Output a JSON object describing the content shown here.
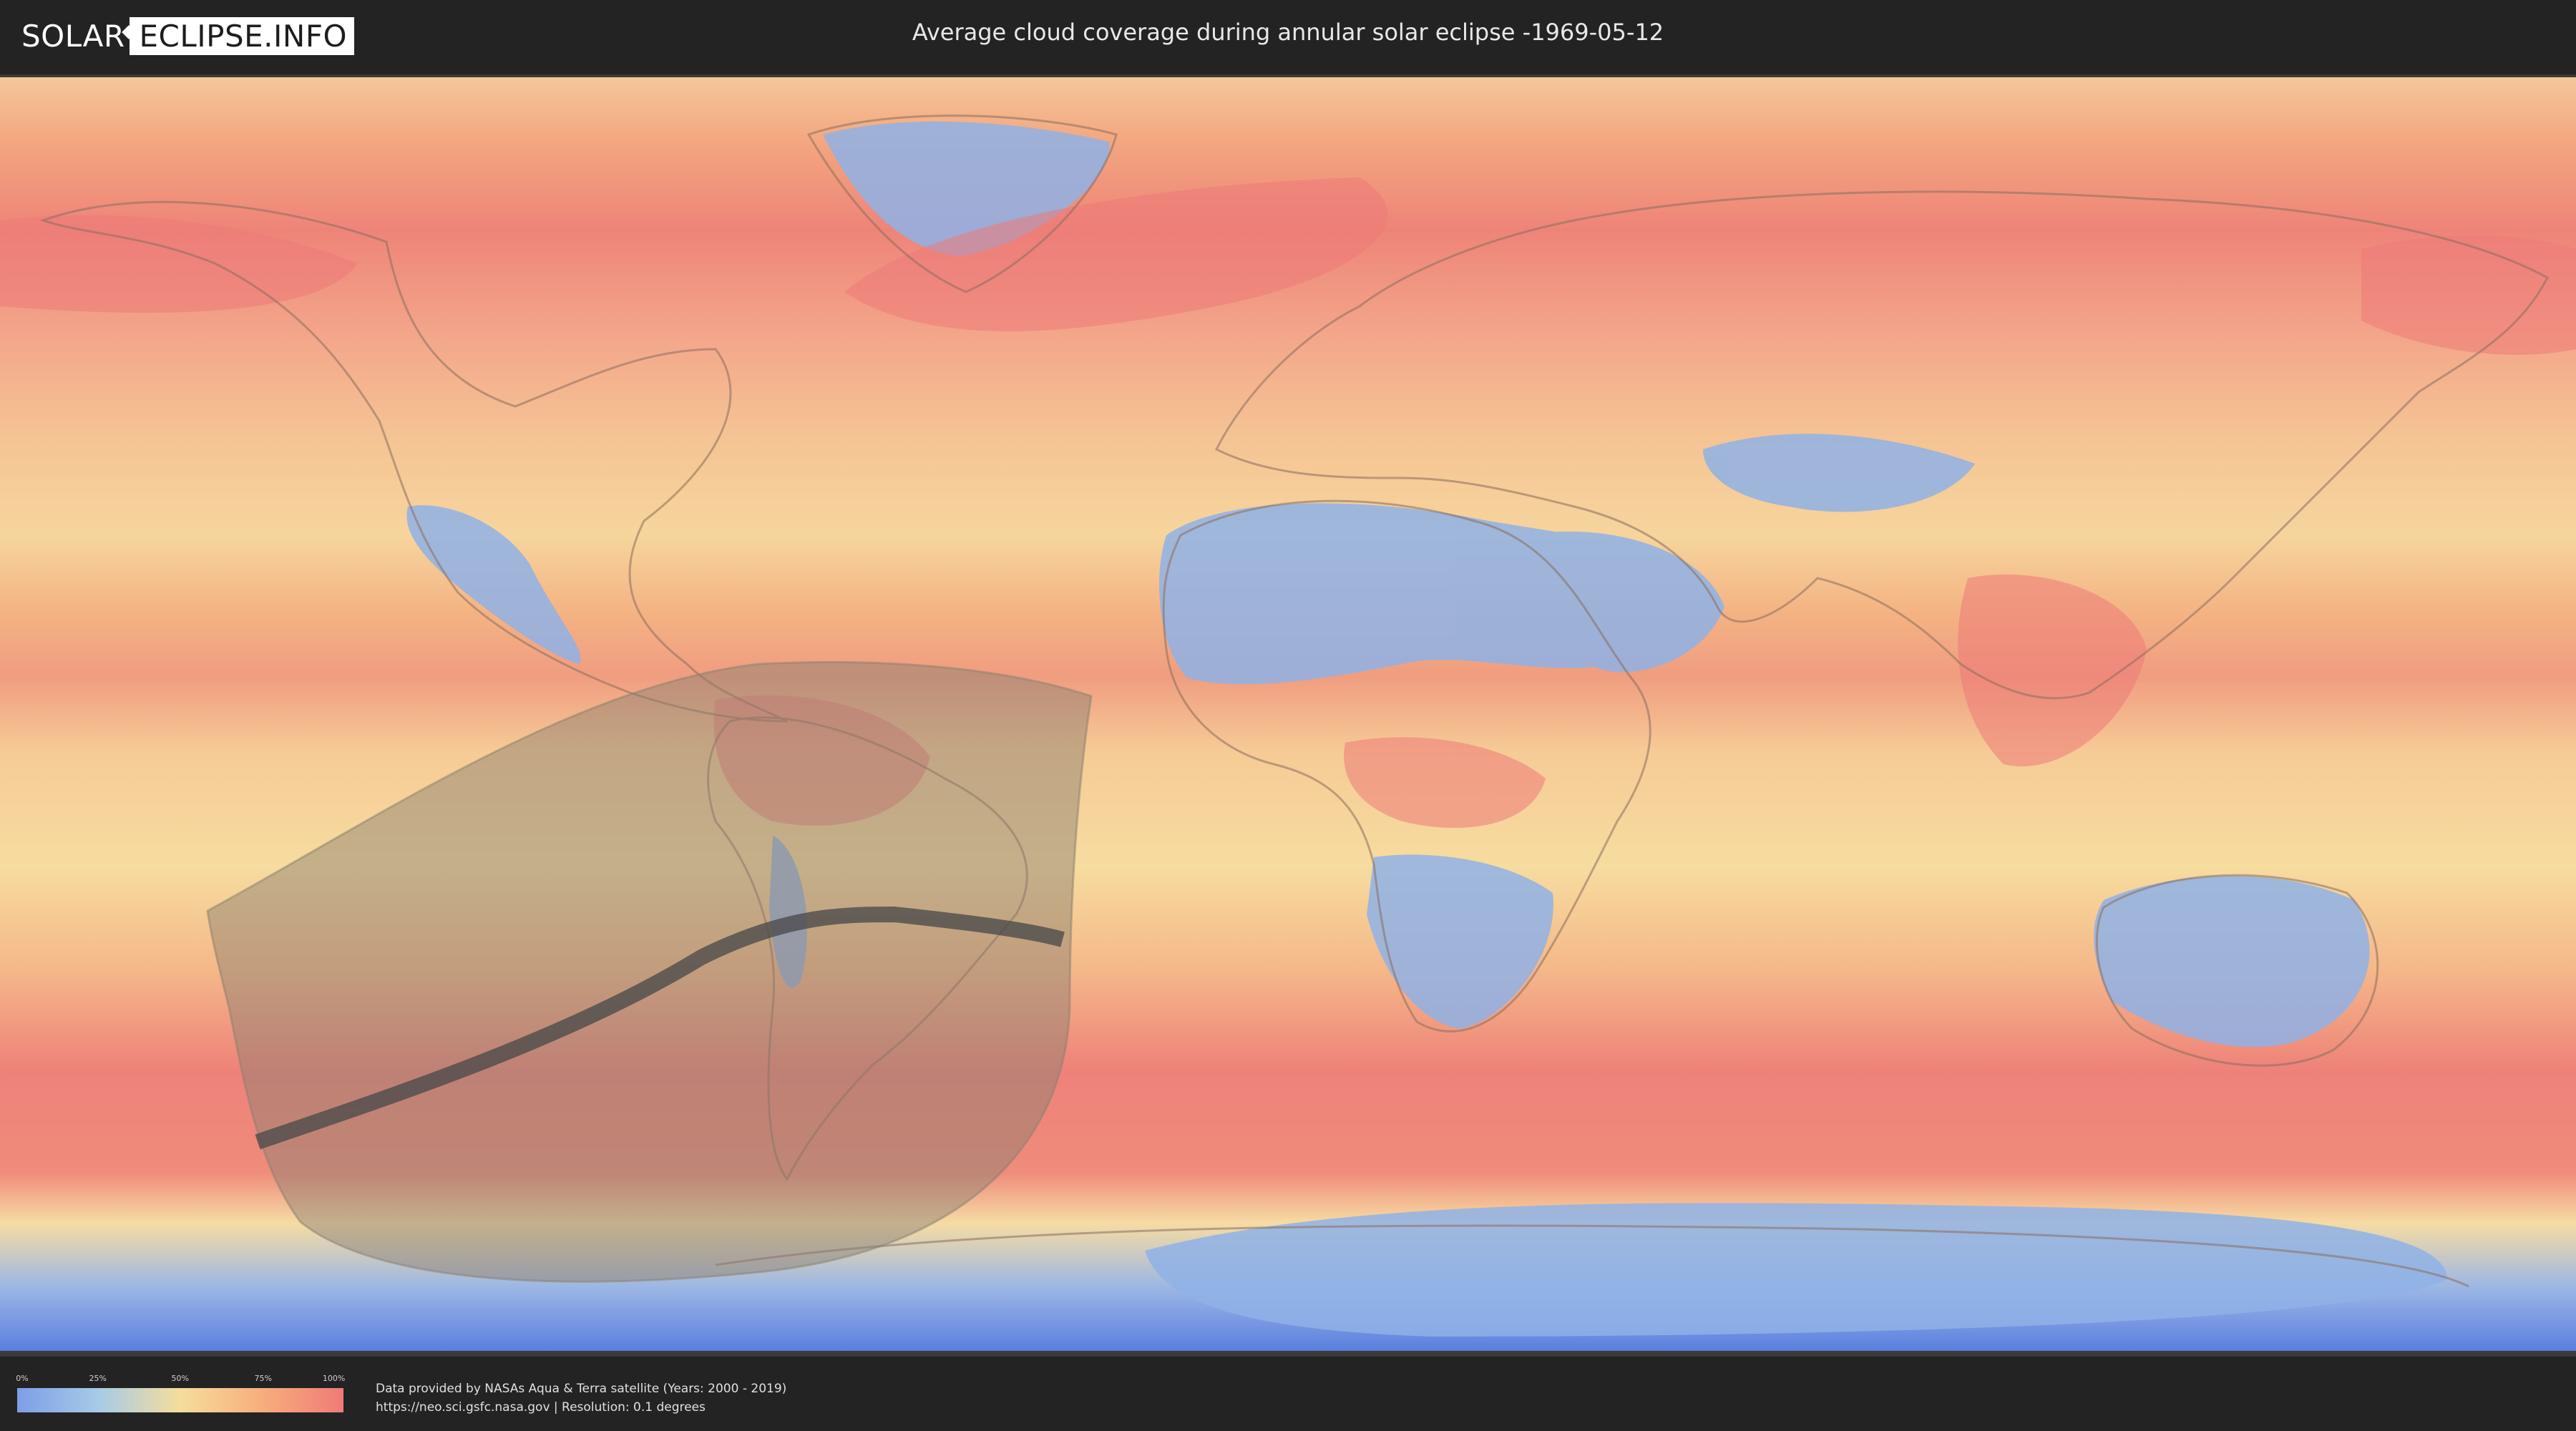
{
  "header": {
    "logo_part1": "SOLAR",
    "logo_part2": "ECLIPSE.INFO",
    "title": "Average cloud coverage during annular solar eclipse -1969-05-12"
  },
  "legend": {
    "ticks": [
      "0%",
      "25%",
      "50%",
      "75%",
      "100%"
    ],
    "colors": [
      "#7d9ee8",
      "#a7cbe6",
      "#f5dd9c",
      "#f7ae7c",
      "#ef7b78"
    ]
  },
  "credits": {
    "line1": "Data provided by NASAs Aqua & Terra satellite (Years: 2000 - 2019)",
    "line2": "https://neo.sci.gsfc.nasa.gov | Resolution: 0.1 degrees"
  },
  "map": {
    "projection": "equirectangular",
    "overlay_shadow_color": "#8c8070",
    "central_path_color": "#4a4a4a"
  }
}
